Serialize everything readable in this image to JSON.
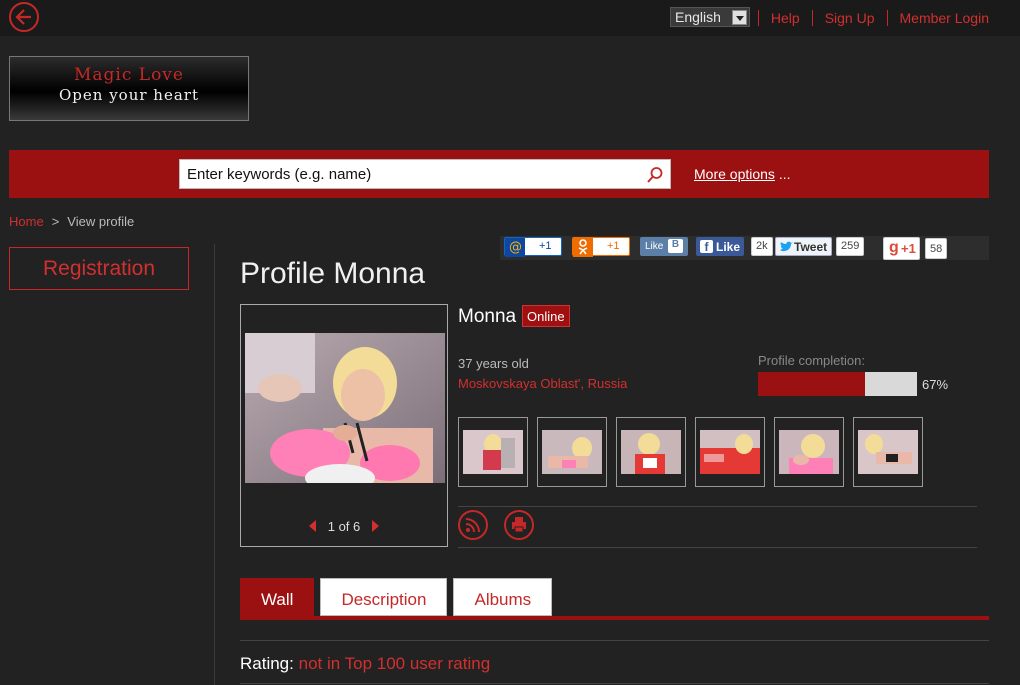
{
  "header": {
    "language": "English",
    "links": [
      "Help",
      "Sign Up",
      "Member Login"
    ]
  },
  "logo": {
    "line1": "Magic Love",
    "line2": "Open your heart"
  },
  "search": {
    "placeholder": "Enter keywords (e.g. name)",
    "more_options_link": "More options",
    "more_options_suffix": " ..."
  },
  "breadcrumb": {
    "home": "Home",
    "separator": ">",
    "current": "View profile"
  },
  "sidebar": {
    "registration": "Registration"
  },
  "social": {
    "mailru_label": "+1",
    "ok_label": "+1",
    "vk_like": "Like",
    "vk_letter": "B",
    "fb_like": "Like",
    "fb_count": "2k",
    "tweet": "Tweet",
    "tweet_count": "259",
    "gplus_label": "+1",
    "gplus_count": "58"
  },
  "profile": {
    "title": "Profile Monna",
    "name": "Monna",
    "status": "Online",
    "age": "37 years old",
    "location": "Moskovskaya Oblast', Russia",
    "completion_label": "Profile completion:",
    "completion_percent": 67,
    "completion_text": "67%",
    "photo_pager": "1 of 6",
    "thumbnail_count": 6
  },
  "tabs": [
    "Wall",
    "Description",
    "Albums"
  ],
  "rating": {
    "label": "Rating:",
    "value": "not in Top 100 user rating"
  },
  "colors": {
    "accent": "#9b1010",
    "link": "#d32f2f",
    "background": "#222222"
  }
}
